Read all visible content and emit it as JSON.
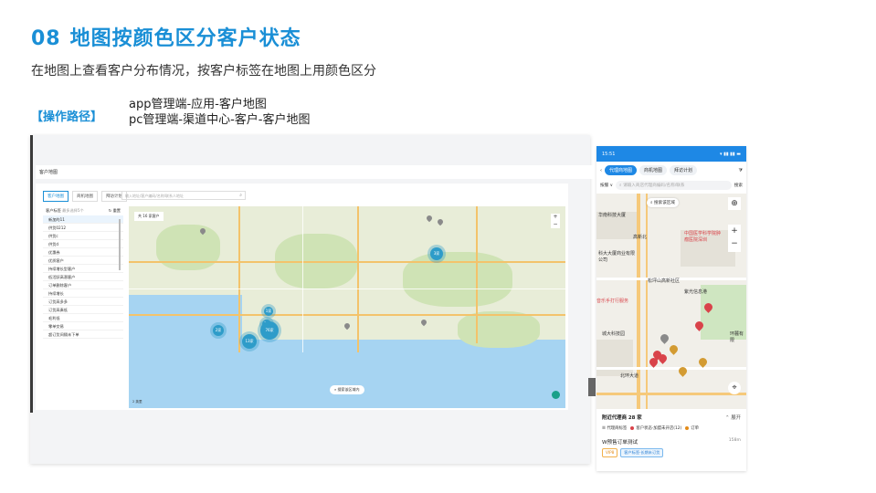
{
  "slide": {
    "number": "08",
    "title": "地图按颜色区分客户状态",
    "description": "在地图上查看客户分布情况，按客户标签在地图上用颜色区分",
    "route_label": "【操作路径】",
    "route_lines": [
      "app管理端-应用-客户地图",
      "pc管理端-渠道中心-客户-客户地图"
    ]
  },
  "pc": {
    "header_title": "客户地图",
    "tabs": [
      {
        "label": "客户地图",
        "active": true
      },
      {
        "label": "商机地图",
        "active": false
      },
      {
        "label": "拜访计划",
        "active": false
      }
    ],
    "search_placeholder": "输入地址/客户编码/名称/联系人地址",
    "list_title": "客户标签",
    "list_sub": "最多选择5个",
    "list_reset": "重置",
    "list_items": [
      "新加的11",
      "供货0212",
      "供货c",
      "供货d",
      "优惠券",
      "优质客户",
      "持续增长型客户",
      "低活跃高潜客户",
      "订单删除客户",
      "持续增长",
      "订货高多多",
      "订货高奏低",
      "毛利低",
      "零单交易",
      "超订货间隔未下单"
    ],
    "filter_label": "共 16 家客户",
    "region_button": "搜索该区域内",
    "scale_text": "2 英里",
    "clusters": [
      {
        "label": "3家"
      },
      {
        "label": "1家"
      },
      {
        "label": "2家"
      },
      {
        "label": "7家"
      },
      {
        "label": "76家"
      },
      {
        "label": "13家"
      }
    ]
  },
  "phone": {
    "time": "15:51",
    "status_icons": "▾ ▮▮ ▮▮ ▬",
    "tabs": [
      {
        "label": "代理商地图",
        "active": true
      },
      {
        "label": "商机地图",
        "active": false
      },
      {
        "label": "拜访计划",
        "active": false
      }
    ],
    "search_type": "按服 ∨",
    "search_placeholder": "请输入商店代理商编码/名称/联系",
    "search_button": "搜索",
    "map_pill": "搜索该区域",
    "map_labels": {
      "a": "华南科技大厦",
      "b": "高新北",
      "c": "中国医学科学院肿瘤医院深圳",
      "d": "科大大厦商业有限公司",
      "e": "松坪山高新社区",
      "f": "紫光信息港",
      "g": "音乐手打行服务",
      "h": "城大科技园",
      "i": "环麓有限",
      "j": "北环大道"
    },
    "nearby_title": "附近代理商 28 家",
    "nearby_expand": "展开",
    "legend": [
      {
        "label": "代理商标签",
        "color": "#1e88e5"
      },
      {
        "label": "客户状态·加盟未开店(12)",
        "color": "#d9434a"
      },
      {
        "label": "订单",
        "color": "#e38b18"
      }
    ],
    "item": {
      "name": "W预售订单测试",
      "distance": "158m",
      "tags": [
        "VIP8",
        "客户标签·长期未订货"
      ]
    }
  }
}
